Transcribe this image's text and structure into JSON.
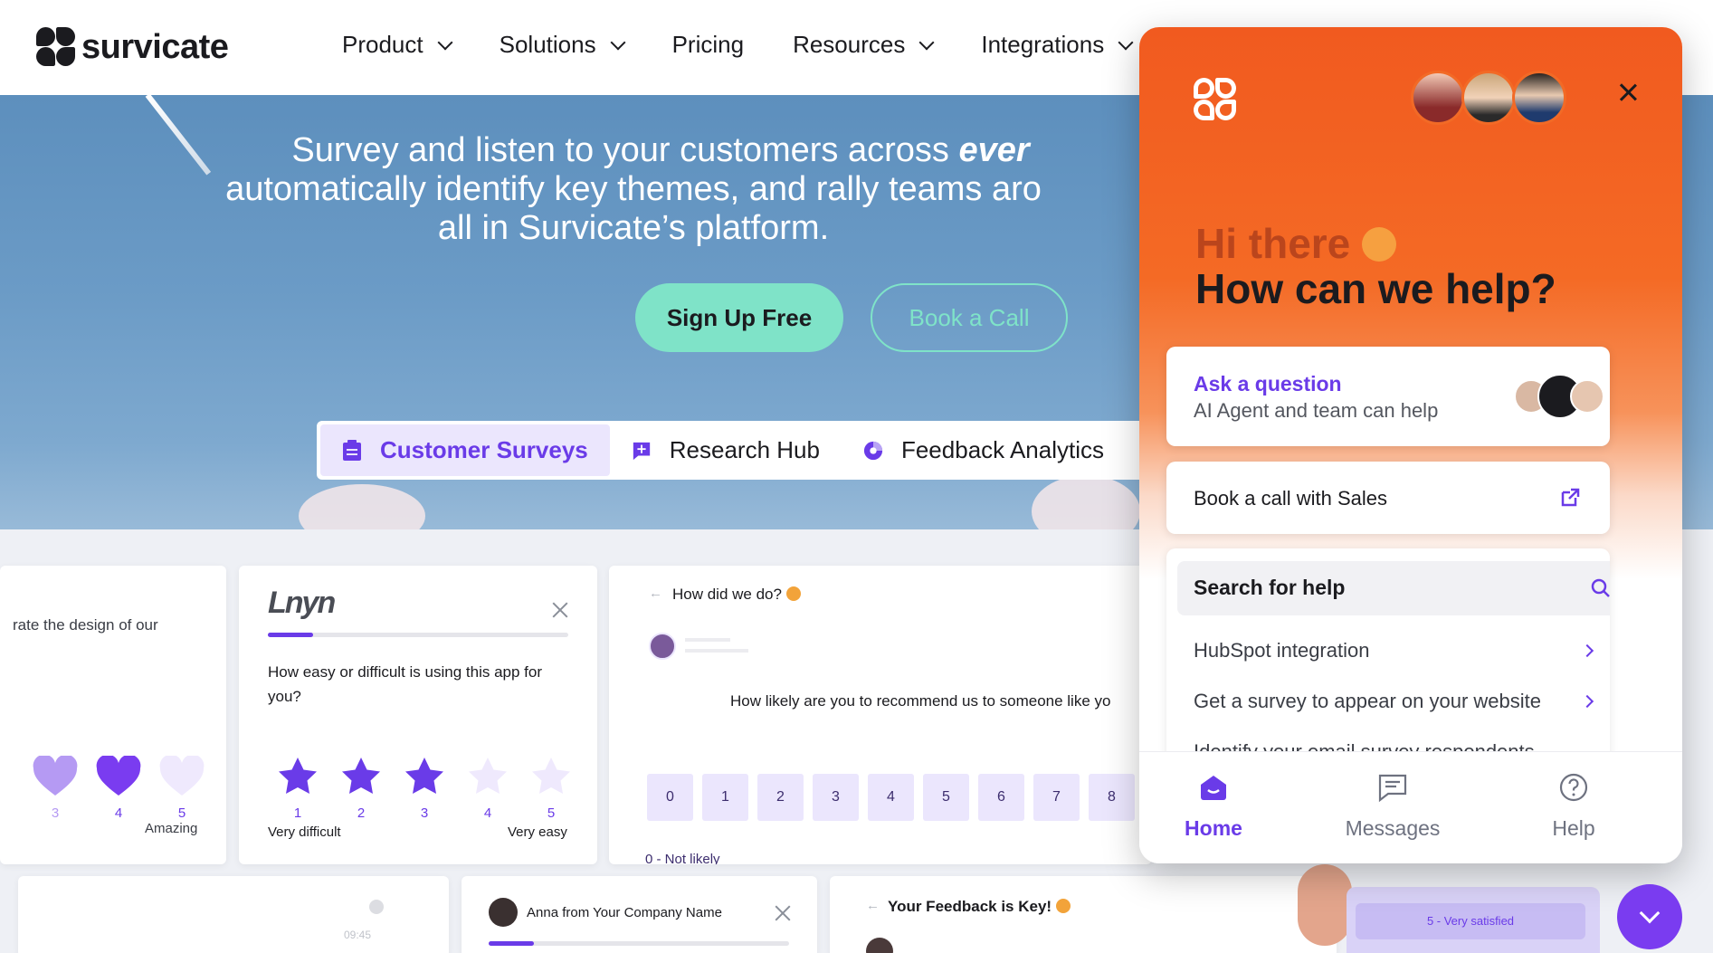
{
  "brand": {
    "name": "survicate"
  },
  "nav": {
    "items": [
      {
        "label": "Product",
        "dropdown": true
      },
      {
        "label": "Solutions",
        "dropdown": true
      },
      {
        "label": "Pricing",
        "dropdown": false
      },
      {
        "label": "Resources",
        "dropdown": true
      },
      {
        "label": "Integrations",
        "dropdown": true
      }
    ]
  },
  "hero": {
    "line1": "Survey and listen to your customers across ",
    "line1_em": "ever",
    "line2": "automatically identify key themes, and rally teams aro",
    "line3": "all in Survicate’s platform.",
    "signup_label": "Sign Up Free",
    "book_label": "Book a Call",
    "tabs": [
      {
        "label": "Customer Surveys",
        "icon": "clipboard-icon",
        "active": true
      },
      {
        "label": "Research Hub",
        "icon": "chat-plus-icon",
        "active": false
      },
      {
        "label": "Feedback Analytics",
        "icon": "pie-chart-icon",
        "active": false
      }
    ]
  },
  "cards": {
    "hearts": {
      "question": "rate the design of our",
      "numbers": [
        "3",
        "4",
        "5"
      ],
      "end_label": "Amazing"
    },
    "stars": {
      "brand_logo": "Lnyn",
      "question": "How easy or difficult is using this app for you?",
      "numbers": [
        "1",
        "2",
        "3",
        "4",
        "5"
      ],
      "filled": 3,
      "progress": 0.15,
      "min_label": "Very difficult",
      "max_label": "Very easy"
    },
    "nps": {
      "title": "How did we do?",
      "question": "How likely are you to recommend us to someone like yo",
      "scale": [
        "0",
        "1",
        "2",
        "3",
        "4",
        "5",
        "6",
        "7",
        "8"
      ],
      "min_label": "0 - Not likely"
    },
    "anna": {
      "sender": "Anna from Your Company Name",
      "progress": 0.15
    },
    "chat_time": "09:45",
    "feedback": {
      "title": "Your Feedback is Key!",
      "option": "5 - Very satisfied"
    }
  },
  "widget": {
    "greeting": "Hi there",
    "headline": "How can we help?",
    "ask_title": "Ask a question",
    "ask_sub": "AI Agent and team can help",
    "book_sales": "Book a call with Sales",
    "search_label": "Search for help",
    "help_items": [
      "HubSpot integration",
      "Get a survey to appear on your website",
      "Identify your email survey respondents"
    ],
    "bottom_tabs": [
      {
        "label": "Home",
        "icon": "home-icon",
        "active": true
      },
      {
        "label": "Messages",
        "icon": "messages-icon",
        "active": false
      },
      {
        "label": "Help",
        "icon": "help-icon",
        "active": false
      }
    ]
  },
  "colors": {
    "accent": "#6a3be8",
    "widget_orange": "#f15a1f",
    "mint": "#7fe3c8"
  }
}
